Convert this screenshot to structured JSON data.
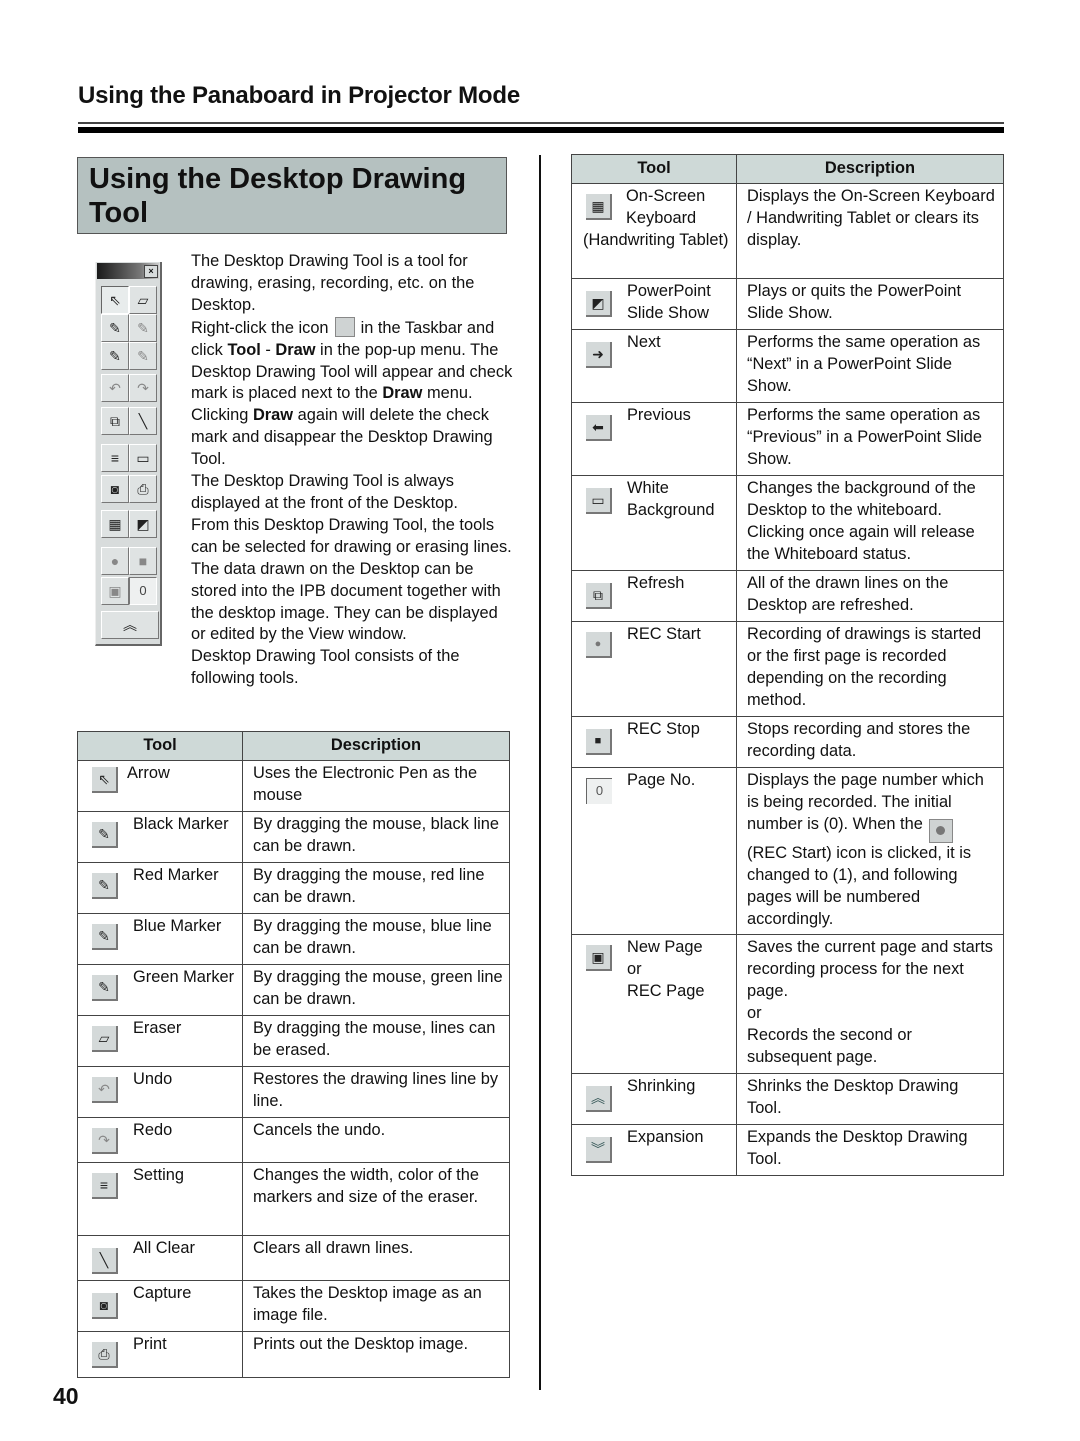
{
  "header": {
    "section_title": "Using the Panaboard in Projector Mode",
    "heading": "Using the Desktop Drawing Tool"
  },
  "intro": {
    "p1": "The Desktop Drawing Tool is a tool for drawing, erasing, recording, etc. on the Desktop.",
    "p2_a": "Right-click the icon",
    "p2_b": "in the Taskbar and click",
    "p2_tool": "Tool",
    "p2_dash": " - ",
    "p2_draw": "Draw",
    "p2_c": "in the pop-up menu. The Desktop Drawing Tool will appear and check mark is placed next to the",
    "p2_draw2": "Draw",
    "p2_d": "menu. Clicking",
    "p2_draw3": "Draw",
    "p2_e": "again will delete the check mark and disappear the Desktop Drawing Tool.",
    "p3": "The Desktop Drawing Tool is always displayed at the front of the Desktop.",
    "p4": "From this Desktop Drawing Tool, the tools can be selected for drawing or erasing lines.",
    "p5": "The data drawn on the Desktop can be stored into the IPB document together with the desktop image. They can be displayed or edited by the View window.",
    "p6": "Desktop Drawing Tool consists of the following tools."
  },
  "toolbar": {
    "close_glyph": "×",
    "page_counter": "0",
    "buttons": [
      {
        "name": "arrow",
        "glyph": "⇖"
      },
      {
        "name": "eraser",
        "glyph": "▱"
      },
      {
        "name": "black-marker",
        "glyph": "✎"
      },
      {
        "name": "red-marker",
        "glyph": "✎"
      },
      {
        "name": "blue-marker",
        "glyph": "✎"
      },
      {
        "name": "green-marker",
        "glyph": "✎"
      },
      {
        "name": "undo",
        "glyph": "↶"
      },
      {
        "name": "redo",
        "glyph": "↷"
      },
      {
        "name": "refresh",
        "glyph": "⧉"
      },
      {
        "name": "all-clear",
        "glyph": "╲"
      },
      {
        "name": "setting",
        "glyph": "≡"
      },
      {
        "name": "white-background",
        "glyph": "▭"
      },
      {
        "name": "capture",
        "glyph": "◙"
      },
      {
        "name": "print",
        "glyph": "⎙"
      },
      {
        "name": "on-screen-keyboard",
        "glyph": "▦"
      },
      {
        "name": "powerpoint-slide-show",
        "glyph": "◩"
      },
      {
        "name": "rec-start",
        "glyph": "●"
      },
      {
        "name": "rec-stop",
        "glyph": "■"
      },
      {
        "name": "new-page",
        "glyph": "▣"
      },
      {
        "name": "shrinking",
        "glyph": "︽"
      }
    ]
  },
  "table_headers": {
    "tool": "Tool",
    "description": "Description"
  },
  "left_table": [
    {
      "tool": "Arrow",
      "desc": "Uses the Electronic Pen as the mouse",
      "glyph": "⇖"
    },
    {
      "tool": "Black Marker",
      "desc": "By dragging the mouse, black line can be drawn.",
      "glyph": "✎"
    },
    {
      "tool": "Red Marker",
      "desc": "By dragging the mouse, red line can be drawn.",
      "glyph": "✎"
    },
    {
      "tool": "Blue Marker",
      "desc": "By dragging the mouse, blue line can be drawn.",
      "glyph": "✎"
    },
    {
      "tool": "Green Marker",
      "desc": "By dragging the mouse, green line can be drawn.",
      "glyph": "✎"
    },
    {
      "tool": "Eraser",
      "desc": "By dragging the mouse, lines can be erased.",
      "glyph": "▱"
    },
    {
      "tool": "Undo",
      "desc": "Restores the drawing lines line by line.",
      "glyph": "↶"
    },
    {
      "tool": "Redo",
      "desc": "Cancels the undo.",
      "glyph": "↷"
    },
    {
      "tool": "Setting",
      "desc": "Changes the width, color of the markers and size of the eraser.",
      "glyph": "≡"
    },
    {
      "tool": "All Clear",
      "desc": "Clears all drawn lines.",
      "glyph": "╲"
    },
    {
      "tool": "Capture",
      "desc": "Takes the Desktop image as an image file.",
      "glyph": "◙"
    },
    {
      "tool": "Print",
      "desc": "Prints out the Desktop image.",
      "glyph": "⎙"
    }
  ],
  "right_table": [
    {
      "tool_line1": "On-Screen",
      "tool_line2": "Keyboard",
      "tool_rest": "(Handwriting Tablet)",
      "desc": "Displays the On-Screen Keyboard / Handwriting Tablet or clears its display.",
      "glyph": "▦"
    },
    {
      "tool": "PowerPoint Slide Show",
      "desc": "Plays or quits the PowerPoint Slide Show.",
      "glyph": "◩"
    },
    {
      "tool": "Next",
      "desc": "Performs the same operation as “Next” in a PowerPoint Slide Show.",
      "glyph": "➜"
    },
    {
      "tool": "Previous",
      "desc": "Performs the same operation as “Previous” in a PowerPoint Slide Show.",
      "glyph": "⬅"
    },
    {
      "tool": "White Background",
      "desc": "Changes the background of the Desktop to the whiteboard. Clicking once again will release the Whiteboard status.",
      "glyph": "▭"
    },
    {
      "tool": "Refresh",
      "desc": "All of the drawn lines on the Desktop are refreshed.",
      "glyph": "⧉"
    },
    {
      "tool": "REC Start",
      "desc": "Recording of drawings is started or the first page is recorded depending on the recording method.",
      "glyph": "●"
    },
    {
      "tool": "REC Stop",
      "desc": "Stops recording and stores the recording data.",
      "glyph": "■"
    },
    {
      "tool": "Page No.",
      "desc_a": "Displays the page number which is being recorded. The initial number is (0). When the",
      "desc_b": "(REC Start) icon is clicked, it is changed to (1), and following pages will be numbered accordingly.",
      "glyph": "0"
    },
    {
      "tool_l1": "New Page",
      "tool_l2": "or",
      "tool_l3": "REC Page",
      "desc_l1": "Saves the current page and starts recording process for the next page.",
      "desc_l2": "or",
      "desc_l3": "Records the second or subsequent page.",
      "glyph": "▣"
    },
    {
      "tool": "Shrinking",
      "desc": "Shrinks the Desktop Drawing Tool.",
      "glyph": "︽"
    },
    {
      "tool": "Expansion",
      "desc": "Expands the Desktop Drawing Tool.",
      "glyph": "︾"
    }
  ],
  "footer": {
    "page_number": "40"
  }
}
